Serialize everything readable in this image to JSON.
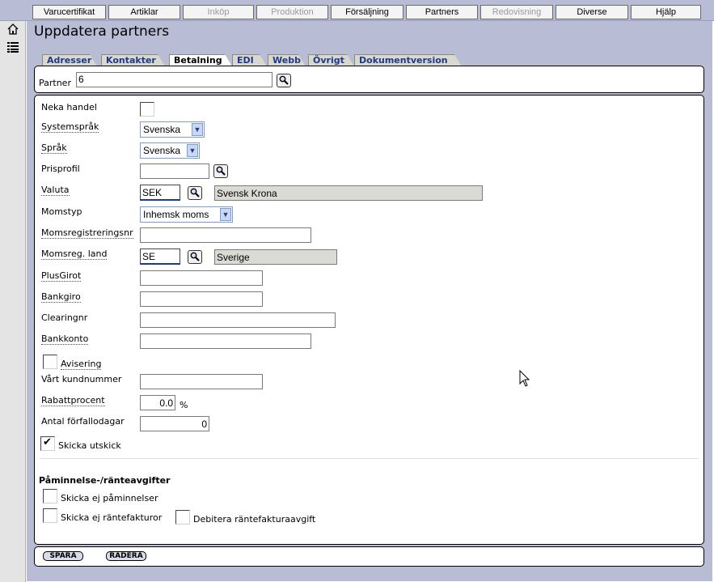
{
  "menu": [
    {
      "label": "Varucertifikat",
      "enabled": true
    },
    {
      "label": "Artiklar",
      "enabled": true
    },
    {
      "label": "Inköp",
      "enabled": false
    },
    {
      "label": "Produktion",
      "enabled": false
    },
    {
      "label": "Försäljning",
      "enabled": true
    },
    {
      "label": "Partners",
      "enabled": true
    },
    {
      "label": "Redovisning",
      "enabled": false
    },
    {
      "label": "Diverse",
      "enabled": true
    },
    {
      "label": "Hjälp",
      "enabled": true
    }
  ],
  "sidebar": {
    "icons": [
      "home-icon",
      "list-icon"
    ]
  },
  "page": {
    "title": "Uppdatera partners"
  },
  "tabs": [
    {
      "label": "Adresser"
    },
    {
      "label": "Kontakter"
    },
    {
      "label": "Betalning"
    },
    {
      "label": "EDI"
    },
    {
      "label": "Webb"
    },
    {
      "label": "Övrigt"
    },
    {
      "label": "Dokumentversion"
    }
  ],
  "active_tab": "Betalning",
  "partner": {
    "label": "Partner",
    "value": "6"
  },
  "form": {
    "neka_handel": {
      "label": "Neka handel",
      "checked": false
    },
    "systemsprak": {
      "label": "Systemspråk",
      "value": "Svenska"
    },
    "sprak": {
      "label": "Språk",
      "value": "Svenska"
    },
    "prisprofil": {
      "label": "Prisprofil",
      "value": ""
    },
    "valuta": {
      "label": "Valuta",
      "value": "SEK",
      "description": "Svensk Krona"
    },
    "momstyp": {
      "label": "Momstyp",
      "value": "Inhemsk moms"
    },
    "momsregistreringsnr": {
      "label": "Momsregistreringsnr",
      "value": ""
    },
    "momsreg_land": {
      "label": "Momsreg. land",
      "value": "SE",
      "description": "Sverige"
    },
    "plusgirot": {
      "label": "PlusGirot",
      "value": ""
    },
    "bankgiro": {
      "label": "Bankgiro",
      "value": ""
    },
    "clearingnr": {
      "label": "Clearingnr",
      "value": ""
    },
    "bankkonto": {
      "label": "Bankkonto",
      "value": ""
    },
    "avisering": {
      "label": "Avisering",
      "checked": false
    },
    "vart_kundnummer": {
      "label": "Vårt kundnummer",
      "value": ""
    },
    "rabattprocent": {
      "label": "Rabattprocent",
      "value": "0.0",
      "unit": "%"
    },
    "antal_forfallodagar": {
      "label": "Antal förfallodagar",
      "value": "0"
    },
    "skicka_utskick": {
      "label": "Skicka utskick",
      "checked": true
    }
  },
  "reminders": {
    "heading": "Påminnelse-/ränteavgifter",
    "skicka_ej_paminnelser": {
      "label": "Skicka ej påminnelser",
      "checked": false
    },
    "skicka_ej_rantefakturor": {
      "label": "Skicka ej räntefakturor",
      "checked": false
    },
    "debitera_rantefakturaavgift": {
      "label": "Debitera räntefakturaavgift",
      "checked": false
    }
  },
  "footer": {
    "save_label": "SPARA",
    "delete_label": "RADERA"
  }
}
